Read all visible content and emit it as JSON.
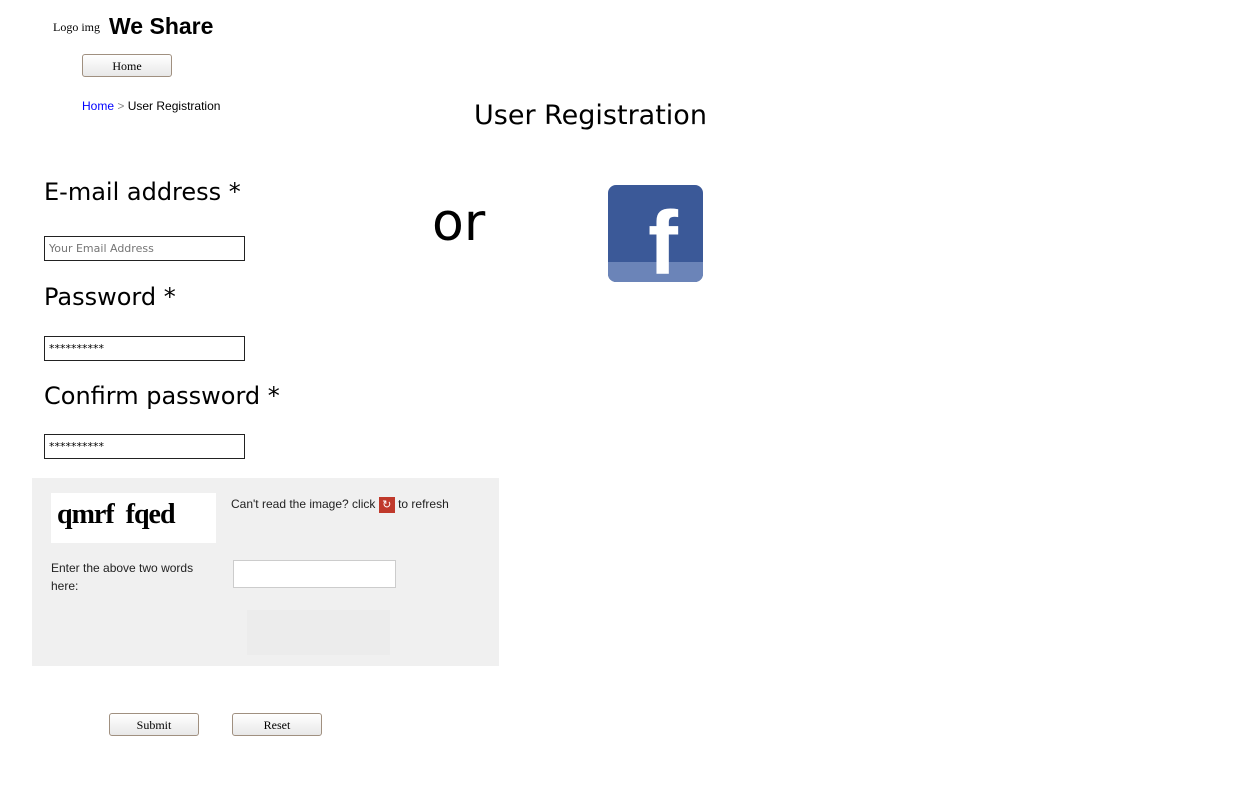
{
  "header": {
    "logo": "Logo img",
    "brand": "We Share",
    "home_button": "Home"
  },
  "breadcrumb": {
    "home": "Home",
    "separator": ">",
    "current": "User Registration"
  },
  "title": "User Registration",
  "form": {
    "email_label": "E-mail address *",
    "email_placeholder": "Your Email Address",
    "password_label": "Password *",
    "password_value": "**********",
    "confirm_label": "Confirm password *",
    "confirm_value": "**********"
  },
  "or_text": "or",
  "captcha": {
    "words": "qmrf  fqed",
    "hint_prefix": "Can't read the image? click",
    "hint_suffix": "to refresh",
    "prompt": "Enter the above two words here:"
  },
  "buttons": {
    "submit": "Submit",
    "reset": "Reset"
  }
}
